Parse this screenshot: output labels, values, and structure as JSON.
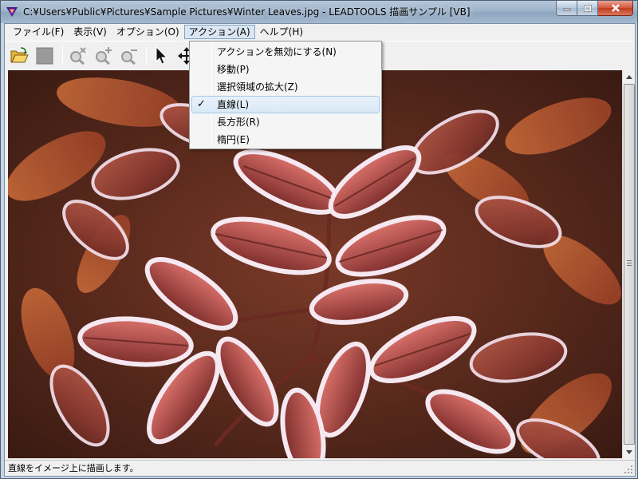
{
  "window": {
    "title": "C:¥Users¥Public¥Pictures¥Sample Pictures¥Winter Leaves.jpg - LEADTOOLS 描画サンプル [VB]"
  },
  "menubar": [
    {
      "label": "ファイル(F)"
    },
    {
      "label": "表示(V)"
    },
    {
      "label": "オプション(O)"
    },
    {
      "label": "アクション(A)"
    },
    {
      "label": "ヘルプ(H)"
    }
  ],
  "action_menu": [
    {
      "label": "アクションを無効にする(N)",
      "checked": false,
      "highlighted": false
    },
    {
      "label": "移動(P)",
      "checked": false,
      "highlighted": false
    },
    {
      "label": "選択領域の拡大(Z)",
      "checked": false,
      "highlighted": false
    },
    {
      "label": "直線(L)",
      "checked": true,
      "highlighted": true
    },
    {
      "label": "長方形(R)",
      "checked": false,
      "highlighted": false
    },
    {
      "label": "楕円(E)",
      "checked": false,
      "highlighted": false
    }
  ],
  "toolbar": {
    "icons": [
      "open-folder-icon",
      "stop-icon",
      "zoom-reset-icon",
      "zoom-in-icon",
      "zoom-out-icon",
      "pointer-icon",
      "move-icon"
    ]
  },
  "status": {
    "text": "直線をイメージ上に描画します。"
  },
  "colors": {
    "check": "#000000",
    "highlight": "#d9e8f7"
  }
}
